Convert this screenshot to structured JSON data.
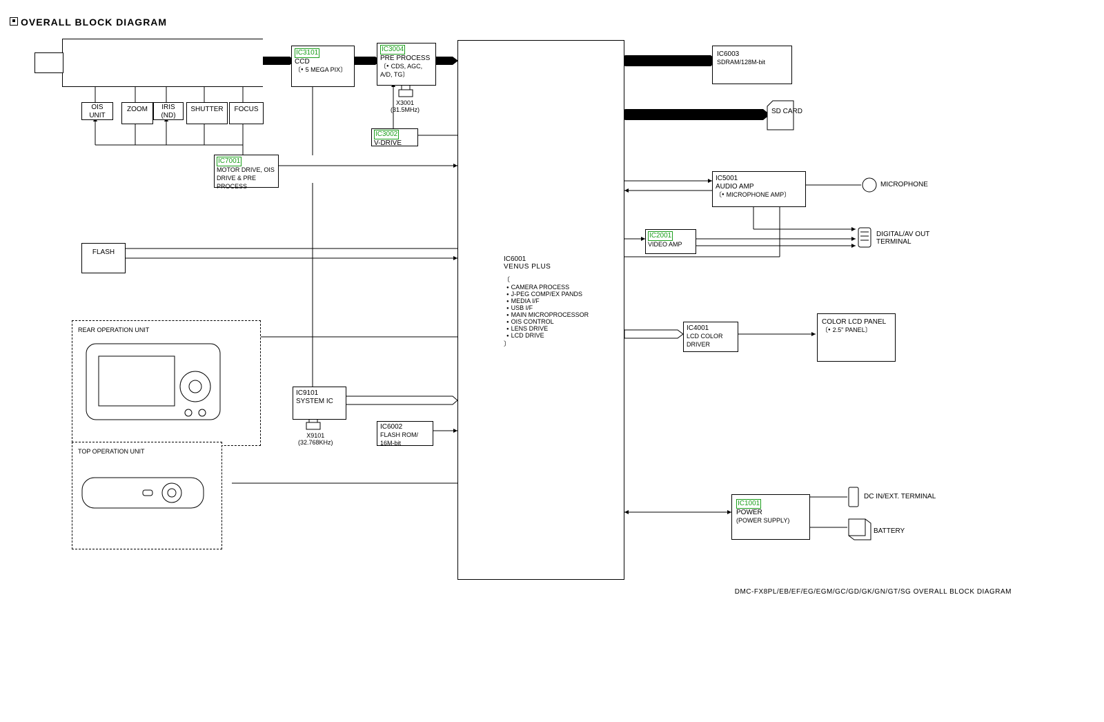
{
  "header": {
    "title": "OVERALL BLOCK DIAGRAM"
  },
  "lens": {
    "ois": "OIS\nUNIT",
    "zoom": "ZOOM",
    "iris": "IRIS\n(ND)",
    "shutter": "SHUTTER",
    "focus": "FOCUS"
  },
  "ic3101": {
    "id": "IC3101",
    "name": "CCD",
    "note": "5 MEGA PIX"
  },
  "ic3004": {
    "id": "IC3004",
    "name": "PRE PROCESS",
    "note": "CDS, AGC, A/D, TG"
  },
  "x3001": {
    "label": "X3001",
    "freq": "(31.5MHz)"
  },
  "ic3002": {
    "id": "IC3002",
    "name": "V-DRIVE"
  },
  "ic7001": {
    "id": "IC7001",
    "name": "MOTOR DRIVE, OIS DRIVE & PRE PROCESS"
  },
  "flash": {
    "label": "FLASH"
  },
  "rear": {
    "label": "REAR OPERATION UNIT"
  },
  "top": {
    "label": "TOP OPERATION UNIT"
  },
  "ic9101": {
    "id": "IC9101",
    "name": "SYSTEM IC"
  },
  "x9101": {
    "label": "X9101",
    "freq": "(32.768KHz)"
  },
  "ic6002": {
    "id": "IC6002",
    "name": "FLASH ROM/ 16M-bit"
  },
  "ic6001": {
    "id": "IC6001",
    "name": "VENUS PLUS",
    "features": [
      "CAMERA PROCESS",
      "J-PEG COMP/EX PANDS",
      "MEDIA I/F",
      "USB I/F",
      "MAIN MICROPROCESSOR",
      "OIS CONTROL",
      "LENS DRIVE",
      "LCD DRIVE"
    ]
  },
  "ic6003": {
    "id": "IC6003",
    "name": "SDRAM/128M-bit"
  },
  "sdcard": {
    "label": "SD CARD"
  },
  "ic5001": {
    "id": "IC5001",
    "name": "AUDIO AMP",
    "note": "MICROPHONE AMP"
  },
  "mic": {
    "label": "MICROPHONE"
  },
  "ic2001": {
    "id": "IC2001",
    "name": "VIDEO AMP"
  },
  "avout": {
    "label": "DIGITAL/AV OUT TERMINAL"
  },
  "ic4001": {
    "id": "IC4001",
    "name": "LCD COLOR DRIVER"
  },
  "lcd": {
    "label": "COLOR LCD PANEL",
    "note": "2.5\" PANEL"
  },
  "ic1001": {
    "id": "IC1001",
    "name": "POWER",
    "note": "(POWER SUPPLY)"
  },
  "dcin": {
    "label": "DC IN/EXT. TERMINAL"
  },
  "batt": {
    "label": "BATTERY"
  },
  "footer": {
    "text": "DMC-FX8PL/EB/EF/EG/EGM/GC/GD/GK/GN/GT/SG   OVERALL BLOCK DIAGRAM"
  },
  "chart_data": {
    "type": "block-diagram",
    "nodes": [
      "IC3101 CCD",
      "IC3004 PRE PROCESS",
      "IC3002 V-DRIVE",
      "IC7001 MOTOR DRIVE/OIS/PRE",
      "IC9101 SYSTEM IC",
      "IC6002 FLASH ROM 16M-bit",
      "IC6001 VENUS PLUS",
      "IC6003 SDRAM 128M-bit",
      "IC5001 AUDIO AMP",
      "IC2001 VIDEO AMP",
      "IC4001 LCD COLOR DRIVER",
      "IC1001 POWER",
      "SD CARD",
      "COLOR LCD PANEL",
      "MICROPHONE",
      "DIGITAL/AV OUT",
      "DC IN",
      "BATTERY",
      "FLASH",
      "OIS UNIT",
      "ZOOM",
      "IRIS",
      "SHUTTER",
      "FOCUS",
      "REAR OPERATION UNIT",
      "TOP OPERATION UNIT"
    ],
    "signal_paths": [
      [
        "lens",
        "IC3101"
      ],
      [
        "IC3101",
        "IC3004"
      ],
      [
        "IC3004",
        "IC6001"
      ],
      [
        "IC3002",
        "IC3004"
      ],
      [
        "IC7001",
        "lens motors"
      ],
      [
        "IC7001",
        "IC6001"
      ],
      [
        "IC9101",
        "IC6001"
      ],
      [
        "IC6002",
        "IC6001"
      ],
      [
        "IC6001",
        "IC6003"
      ],
      [
        "IC6001",
        "SD CARD"
      ],
      [
        "IC6001",
        "IC5001"
      ],
      [
        "IC5001",
        "MICROPHONE"
      ],
      [
        "IC6001",
        "IC2001"
      ],
      [
        "IC2001",
        "AV OUT"
      ],
      [
        "IC5001",
        "AV OUT"
      ],
      [
        "IC6001",
        "IC4001"
      ],
      [
        "IC4001",
        "COLOR LCD"
      ],
      [
        "IC6001",
        "IC1001"
      ],
      [
        "IC1001",
        "DC IN"
      ],
      [
        "IC1001",
        "BATTERY"
      ],
      [
        "FLASH",
        "IC6001"
      ],
      [
        "REAR OP",
        "IC6001"
      ],
      [
        "TOP OP",
        "IC6001"
      ]
    ]
  }
}
